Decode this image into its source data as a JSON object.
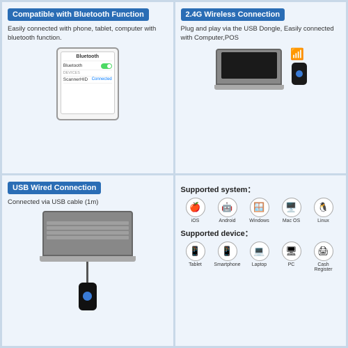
{
  "cells": [
    {
      "id": "bluetooth",
      "title": "Compatible with Bluetooth Function",
      "description": "Easily connected with phone, tablet, computer with bluetooth function.",
      "title_bg": "#2a6db5"
    },
    {
      "id": "wireless",
      "title": "2.4G Wireless Connection",
      "description": "Plug and play via the USB Dongle, Easily connected with Computer,POS",
      "title_bg": "#2a6db5"
    },
    {
      "id": "usb",
      "title": "USB Wired Connection",
      "description": "Connected via USB cable (1m)",
      "title_bg": "#2a6db5"
    },
    {
      "id": "supported",
      "system_title": "Supported system：",
      "device_title": "Supported device：",
      "systems": [
        {
          "icon": "🍎",
          "label": "iOS"
        },
        {
          "icon": "🤖",
          "label": "Android"
        },
        {
          "icon": "🪟",
          "label": "Windows"
        },
        {
          "icon": "🖥️",
          "label": "Mac OS"
        },
        {
          "icon": "🐧",
          "label": "Linux"
        }
      ],
      "devices": [
        {
          "icon": "💻",
          "label": "Tablet"
        },
        {
          "icon": "📱",
          "label": "Smartphone"
        },
        {
          "icon": "🖥",
          "label": "Laptop"
        },
        {
          "icon": "🖥",
          "label": "PC"
        },
        {
          "icon": "🖨",
          "label": "Cash Register"
        }
      ]
    }
  ],
  "bluetooth_ui": {
    "header": "Bluetooth",
    "row1_label": "Bluetooth",
    "row2_label": "DEVICES",
    "row3_label": "ScannerHID",
    "row3_status": "Connected"
  }
}
